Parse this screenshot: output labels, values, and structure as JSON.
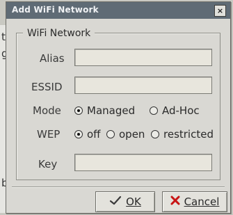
{
  "window": {
    "title": "Add WiFi Network",
    "close_symbol": "×"
  },
  "frame": {
    "legend": "WiFi Network"
  },
  "fields": {
    "alias": {
      "label": "Alias",
      "value": ""
    },
    "essid": {
      "label": "ESSID",
      "value": ""
    },
    "key": {
      "label": "Key",
      "value": ""
    }
  },
  "mode": {
    "label": "Mode",
    "options": [
      "Managed",
      "Ad-Hoc"
    ],
    "selected": "Managed"
  },
  "wep": {
    "label": "WEP",
    "options": [
      "off",
      "open",
      "restricted"
    ],
    "selected": "off"
  },
  "buttons": {
    "ok": {
      "label": "OK",
      "icon": "check-icon"
    },
    "cancel": {
      "label": "Cancel",
      "icon": "cross-icon"
    }
  },
  "colors": {
    "titlebar": "#5f6b75",
    "dialog_bg": "#d9d8d3",
    "field_bg": "#e8e6dd",
    "cancel_icon": "#c81414"
  }
}
